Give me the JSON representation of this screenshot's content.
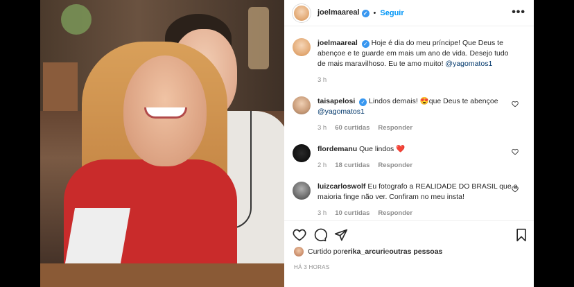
{
  "post": {
    "username": "joelmaareal",
    "follow_label": "Seguir",
    "more_label": "•••",
    "separator": "•",
    "caption": {
      "username": "joelmaareal",
      "text": "Hoje é dia do meu príncipe! Que Deus te abençoe e te guarde em mais um ano de vida. Desejo tudo de mais maravilhoso. Eu te amo muito! ",
      "mention": "@yagomatos1",
      "time": "3 h"
    },
    "comments": [
      {
        "username": "taisapelosi",
        "text": "Lindos demais! 😍que Deus te abençoe ",
        "mention": "@yagomatos1",
        "time": "3 h",
        "likes": "60 curtidas",
        "reply": "Responder"
      },
      {
        "username": "flordemanu",
        "text": "Que lindos ❤️",
        "time": "2 h",
        "likes": "18 curtidas",
        "reply": "Responder"
      },
      {
        "username": "luizcarloswolf",
        "text": "Eu fotografo a REALIDADE DO BRASIL que a maioria finge não ver. Confiram no meu insta!",
        "time": "3 h",
        "likes": "10 curtidas",
        "reply": "Responder"
      }
    ],
    "liked_by": {
      "prefix": "Curtido por ",
      "user": "erika_arcuri",
      "middle": " e ",
      "others": "outras pessoas"
    },
    "timestamp": "HÁ 3 HORAS"
  },
  "colors": {
    "link": "#00376b",
    "follow": "#0095f6",
    "verified": "#3897f0",
    "meta": "#8e8e8e"
  }
}
